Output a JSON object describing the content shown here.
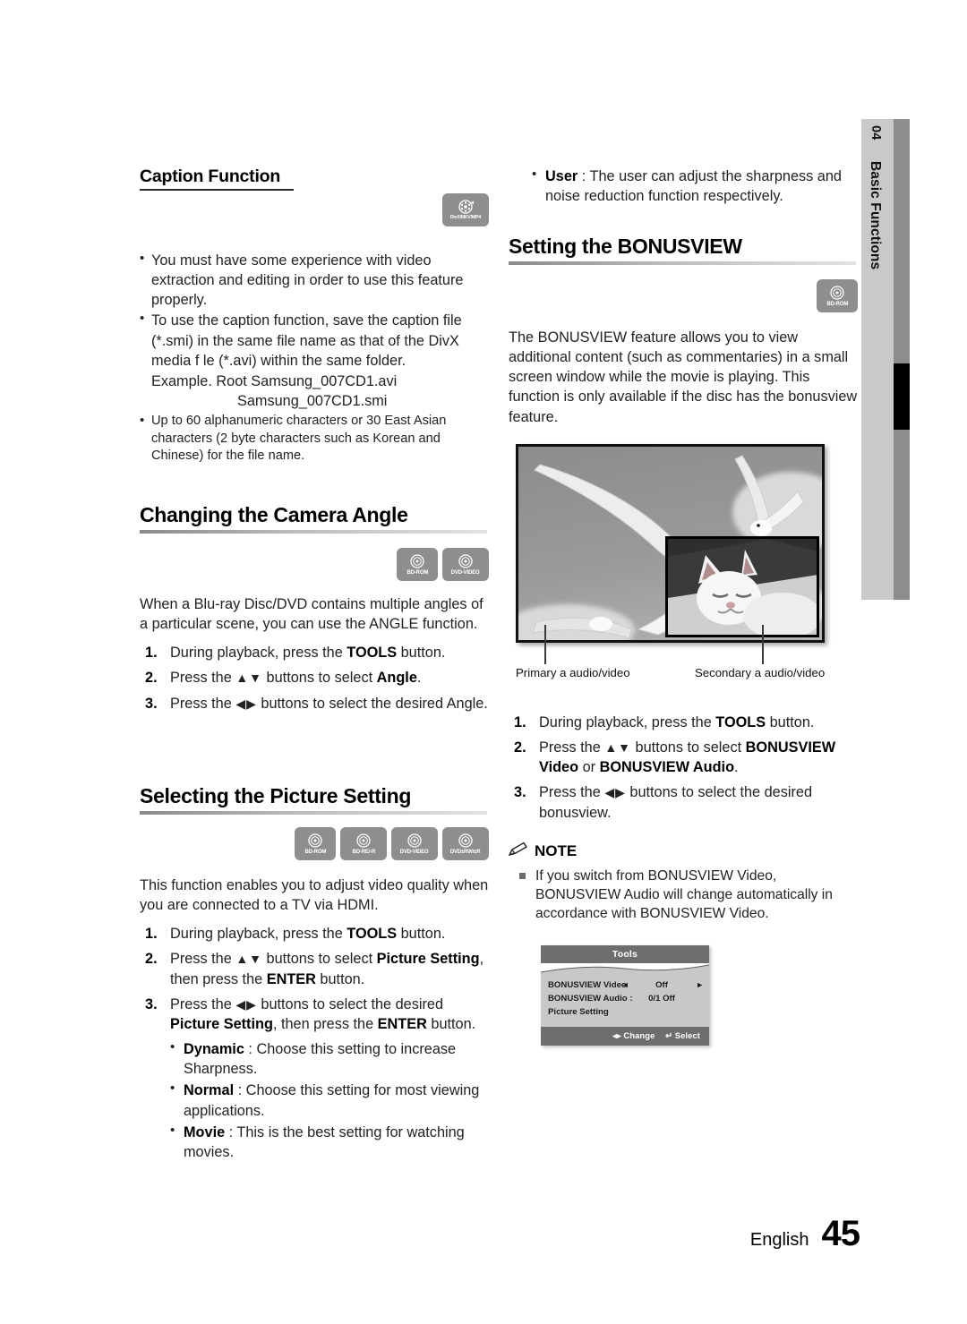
{
  "side_tab": {
    "chapter_number": "04",
    "chapter_label": "Basic Functions"
  },
  "footer": {
    "language": "English",
    "page_number": "45"
  },
  "left_column": {
    "caption_function": {
      "title": "Caption Function",
      "disc_icons": [
        {
          "name": "divx-mkv-mp4-icon",
          "label": "DivX/MKV/MP4"
        }
      ],
      "bullets": [
        "You must have some experience with video extraction and editing in order to use this feature properly.",
        "To use the caption function, save the caption file (*.smi) in the same file name as that of the DivX media f le (*.avi) within the same folder."
      ],
      "example_line1": "Example. Root Samsung_007CD1.avi",
      "example_line2": "Samsung_007CD1.smi",
      "bullet_small": "Up to 60 alphanumeric characters or 30 East Asian characters (2 byte characters such as Korean and Chinese) for the file name."
    },
    "camera_angle": {
      "title": "Changing the Camera Angle",
      "disc_icons": [
        {
          "name": "bd-rom-icon",
          "label": "BD-ROM"
        },
        {
          "name": "dvd-video-icon",
          "label": "DVD-VIDEO"
        }
      ],
      "intro": "When a Blu-ray Disc/DVD contains multiple angles of a particular scene, you can use the ANGLE function.",
      "steps": [
        {
          "pre": "During playback, press the ",
          "bold": "TOOLS",
          "post": " button."
        },
        {
          "pre": "Press the ",
          "arrows": "▲▼",
          "mid": " buttons to select ",
          "bold": "Angle",
          "post": "."
        },
        {
          "pre": "Press the ",
          "arrows": "◀▶",
          "mid": " buttons to select the desired ",
          "bold": "",
          "post": "Angle."
        }
      ]
    },
    "picture_setting": {
      "title": "Selecting the Picture Setting",
      "disc_icons": [
        {
          "name": "bd-rom-icon",
          "label": "BD-ROM"
        },
        {
          "name": "bd-re-r-icon",
          "label": "BD-RE/-R"
        },
        {
          "name": "dvd-video-icon",
          "label": "DVD-VIDEO"
        },
        {
          "name": "dvd-rw-r-icon",
          "label": "DVD±RW/±R"
        }
      ],
      "intro": "This function enables you to adjust video quality when you are connected to a TV via HDMI.",
      "step1_pre": "During playback, press the ",
      "step1_bold": "TOOLS",
      "step1_post": " button.",
      "step2_pre": "Press the ",
      "step2_arrows": "▲▼",
      "step2_mid": " buttons to select ",
      "step2_bold1": "Picture Setting",
      "step2_mid2": ", then press the ",
      "step2_bold2": "ENTER",
      "step2_post": " button.",
      "step3_pre": "Press the ",
      "step3_arrows": "◀▶",
      "step3_mid": " buttons to select the desired ",
      "step3_bold1": "Picture Setting",
      "step3_mid2": ", then press the ",
      "step3_bold2": "ENTER",
      "step3_post": " button.",
      "options": [
        {
          "name": "Dynamic",
          "desc": " : Choose this setting to increase Sharpness."
        },
        {
          "name": "Normal",
          "desc": " : Choose this setting for most viewing applications."
        },
        {
          "name": "Movie",
          "desc": " : This is the best setting for watching movies."
        }
      ]
    }
  },
  "right_column": {
    "user_option": {
      "name": "User",
      "desc": " : The user can adjust the sharpness and noise reduction function respectively."
    },
    "bonusview": {
      "title": "Setting the BONUSVIEW",
      "disc_icons": [
        {
          "name": "bd-rom-icon",
          "label": "BD-ROM"
        }
      ],
      "intro": "The BONUSVIEW feature allows you to view additional content (such as commentaries) in a small screen window while the movie is playing. This function is only available if the disc has the bonusview feature.",
      "figure": {
        "primary_label": "Primary a audio/video",
        "secondary_label": "Secondary a audio/video"
      },
      "step1_pre": "During playback, press the ",
      "step1_bold": "TOOLS",
      "step1_post": " button.",
      "step2_pre": "Press the ",
      "step2_arrows": "▲▼",
      "step2_mid": " buttons to select ",
      "step2_bold1": "BONUSVIEW Video",
      "step2_mid2": " or ",
      "step2_bold2": "BONUSVIEW Audio",
      "step2_post": ".",
      "step3_pre": "Press the ",
      "step3_arrows": "◀▶",
      "step3_mid": " buttons to select the desired bonusview."
    },
    "note": {
      "heading": "NOTE",
      "icon": "pencil-icon",
      "items": [
        "If you switch from BONUSVIEW Video, BONUSVIEW Audio will change automatically in accordance with BONUSVIEW Video."
      ]
    },
    "tools_osd": {
      "title": "Tools",
      "rows": [
        {
          "label": "BONUSVIEW Video",
          "left_arrow": "◂",
          "value": "Off",
          "right_arrow": "▸"
        },
        {
          "label": "BONUSVIEW Audio :",
          "left_arrow": "",
          "value": "0/1 Off",
          "right_arrow": ""
        },
        {
          "label": "Picture Setting",
          "left_arrow": "",
          "value": "",
          "right_arrow": ""
        }
      ],
      "footer_change": "◂▸ Change",
      "footer_select": "↵ Select"
    }
  },
  "colors": {
    "icon_gray": "#8e8e8e",
    "tab_light": "#c9c9c9",
    "tab_dark": "#8d8d8d",
    "osd_header": "#6e6e6e",
    "osd_body": "#c8c8c8"
  }
}
